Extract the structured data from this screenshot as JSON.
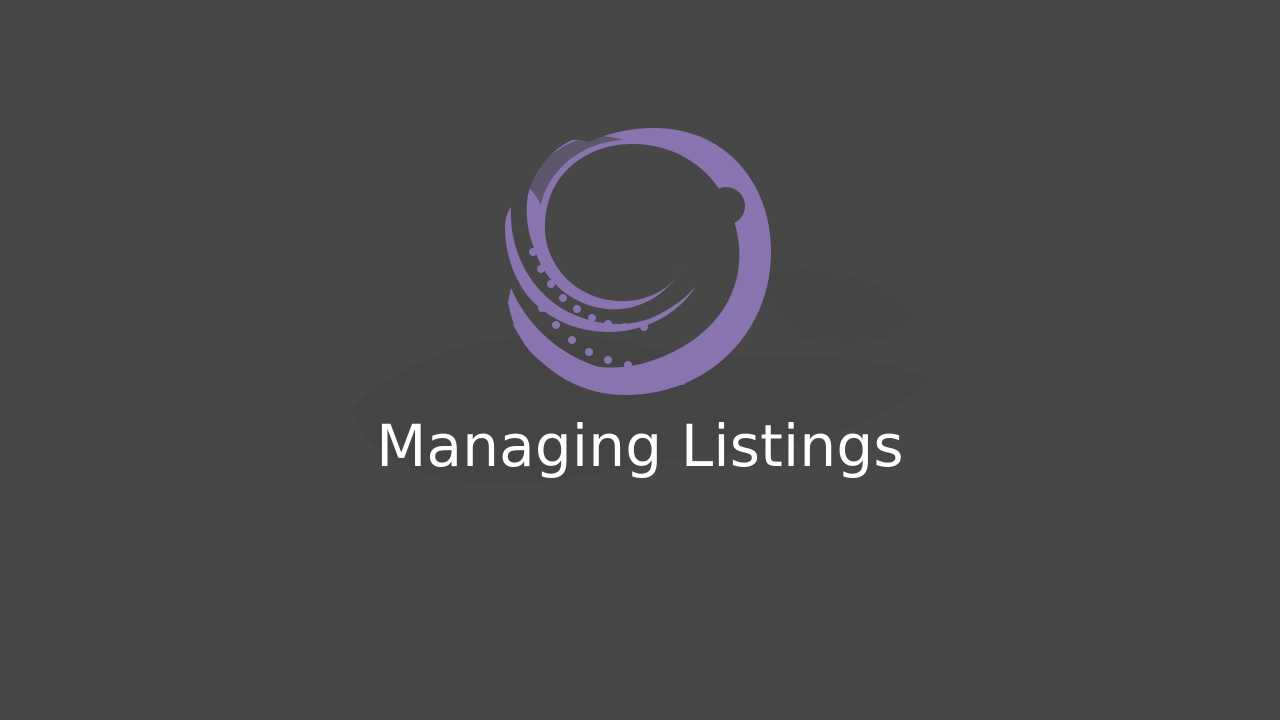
{
  "screen": {
    "title": "Managing Listings",
    "background_color": "#474747",
    "logo": {
      "name": "octopus-logo",
      "color": "#8a74b0",
      "eye_color": "#474747"
    },
    "title_color": "#ffffff"
  }
}
